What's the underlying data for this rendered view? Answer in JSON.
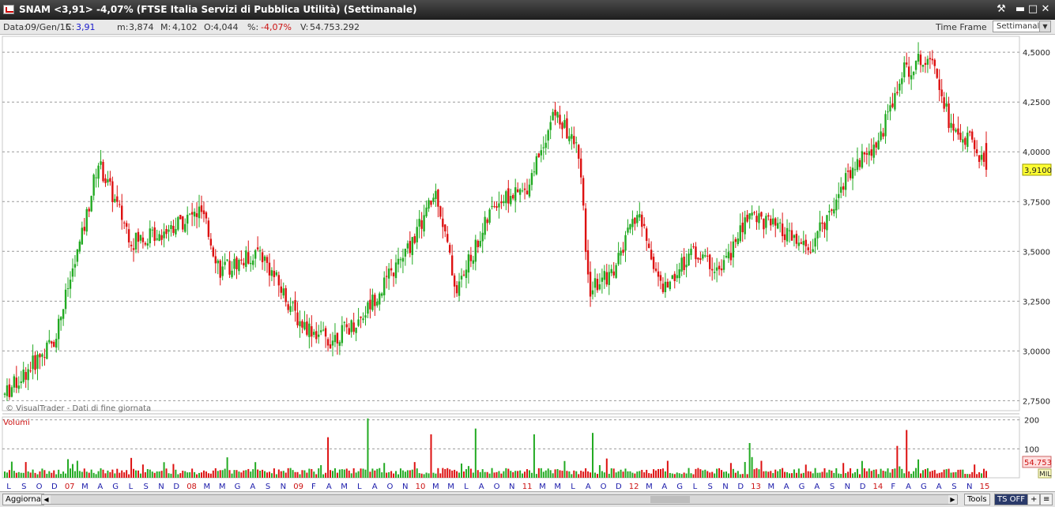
{
  "window": {
    "title": "SNAM <3,91> -4,07%  (FTSE Italia Servizi di Pubblica Utilità)  (Settimanale)",
    "buttons": {
      "tools": "⚒",
      "minimize": "▬",
      "maximize": "□",
      "close": "✕"
    }
  },
  "infobar": {
    "data_label": "Data:",
    "data_value": "09/Gen/15",
    "c_label": "C:",
    "c_value": "3,91",
    "m_label": "m:",
    "m_value": "3,874",
    "M_label": "M:",
    "M_value": "4,102",
    "o_label": "O:",
    "o_value": "4,044",
    "pct_label": "%:",
    "pct_value": "-4,07%",
    "v_label": "V:",
    "v_value": "54.753.292",
    "timeframe_label": "Time Frame",
    "timeframe_value": "Settimanale"
  },
  "chart_data": [
    {
      "type": "candlestick",
      "title": "SNAM <3,91> -4,07%  (FTSE Italia Servizi di Pubblica Utilità)  (Settimanale)",
      "watermark": "© VisualTrader - Dati di fine giornata",
      "y_ticks": [
        "4,5000",
        "4,2500",
        "4,0000",
        "3,7500",
        "3,5000",
        "3,2500",
        "3,0000",
        "2,7500"
      ],
      "ylim": [
        2.7,
        4.58
      ],
      "last_price_label": "3,9100",
      "last_price": 3.91,
      "up_color": "#22aa22",
      "down_color": "#dd1111",
      "grid": true,
      "trend_anchors": [
        {
          "t": 0,
          "p": 2.78
        },
        {
          "t": 0.05,
          "p": 3.05
        },
        {
          "t": 0.08,
          "p": 3.6
        },
        {
          "t": 0.095,
          "p": 3.95
        },
        {
          "t": 0.13,
          "p": 3.55
        },
        {
          "t": 0.16,
          "p": 3.6
        },
        {
          "t": 0.2,
          "p": 3.7
        },
        {
          "t": 0.22,
          "p": 3.4
        },
        {
          "t": 0.26,
          "p": 3.5
        },
        {
          "t": 0.3,
          "p": 3.15
        },
        {
          "t": 0.33,
          "p": 3.05
        },
        {
          "t": 0.36,
          "p": 3.15
        },
        {
          "t": 0.41,
          "p": 3.5
        },
        {
          "t": 0.44,
          "p": 3.8
        },
        {
          "t": 0.46,
          "p": 3.3
        },
        {
          "t": 0.5,
          "p": 3.75
        },
        {
          "t": 0.53,
          "p": 3.8
        },
        {
          "t": 0.56,
          "p": 4.2
        },
        {
          "t": 0.585,
          "p": 4.0
        },
        {
          "t": 0.595,
          "p": 3.3
        },
        {
          "t": 0.62,
          "p": 3.4
        },
        {
          "t": 0.645,
          "p": 3.7
        },
        {
          "t": 0.67,
          "p": 3.3
        },
        {
          "t": 0.7,
          "p": 3.5
        },
        {
          "t": 0.73,
          "p": 3.4
        },
        {
          "t": 0.76,
          "p": 3.7
        },
        {
          "t": 0.79,
          "p": 3.6
        },
        {
          "t": 0.82,
          "p": 3.5
        },
        {
          "t": 0.86,
          "p": 3.9
        },
        {
          "t": 0.89,
          "p": 4.05
        },
        {
          "t": 0.915,
          "p": 4.4
        },
        {
          "t": 0.945,
          "p": 4.5
        },
        {
          "t": 0.965,
          "p": 4.1
        },
        {
          "t": 0.985,
          "p": 4.05
        },
        {
          "t": 1.0,
          "p": 3.91
        }
      ]
    },
    {
      "type": "bar",
      "title": "Volumi",
      "y_ticks": [
        "200",
        "100"
      ],
      "ylim": [
        0,
        210
      ],
      "last_value_label": "54.753",
      "unit_label": "MIL",
      "spikes": [
        {
          "t": 0.37,
          "v": 205
        },
        {
          "t": 0.33,
          "v": 140
        },
        {
          "t": 0.435,
          "v": 150
        },
        {
          "t": 0.48,
          "v": 170
        },
        {
          "t": 0.6,
          "v": 155
        },
        {
          "t": 0.54,
          "v": 150
        },
        {
          "t": 0.76,
          "v": 120
        },
        {
          "t": 0.92,
          "v": 165
        },
        {
          "t": 0.91,
          "v": 110
        }
      ]
    }
  ],
  "x_axis_labels": [
    {
      "text": "L",
      "year": false
    },
    {
      "text": "S",
      "year": false
    },
    {
      "text": "O",
      "year": false
    },
    {
      "text": "D",
      "year": false
    },
    {
      "text": "07",
      "year": true
    },
    {
      "text": "M",
      "year": false
    },
    {
      "text": "A",
      "year": false
    },
    {
      "text": "G",
      "year": false
    },
    {
      "text": "L",
      "year": false
    },
    {
      "text": "S",
      "year": false
    },
    {
      "text": "N",
      "year": false
    },
    {
      "text": "D",
      "year": false
    },
    {
      "text": "08",
      "year": true
    },
    {
      "text": "M",
      "year": false
    },
    {
      "text": "M",
      "year": false
    },
    {
      "text": "G",
      "year": false
    },
    {
      "text": "A",
      "year": false
    },
    {
      "text": "S",
      "year": false
    },
    {
      "text": "N",
      "year": false
    },
    {
      "text": "09",
      "year": true
    },
    {
      "text": "F",
      "year": false
    },
    {
      "text": "A",
      "year": false
    },
    {
      "text": "M",
      "year": false
    },
    {
      "text": "L",
      "year": false
    },
    {
      "text": "A",
      "year": false
    },
    {
      "text": "O",
      "year": false
    },
    {
      "text": "N",
      "year": false
    },
    {
      "text": "10",
      "year": true
    },
    {
      "text": "M",
      "year": false
    },
    {
      "text": "M",
      "year": false
    },
    {
      "text": "L",
      "year": false
    },
    {
      "text": "A",
      "year": false
    },
    {
      "text": "O",
      "year": false
    },
    {
      "text": "N",
      "year": false
    },
    {
      "text": "11",
      "year": true
    },
    {
      "text": "M",
      "year": false
    },
    {
      "text": "M",
      "year": false
    },
    {
      "text": "L",
      "year": false
    },
    {
      "text": "A",
      "year": false
    },
    {
      "text": "O",
      "year": false
    },
    {
      "text": "D",
      "year": false
    },
    {
      "text": "12",
      "year": true
    },
    {
      "text": "M",
      "year": false
    },
    {
      "text": "A",
      "year": false
    },
    {
      "text": "G",
      "year": false
    },
    {
      "text": "L",
      "year": false
    },
    {
      "text": "S",
      "year": false
    },
    {
      "text": "N",
      "year": false
    },
    {
      "text": "D",
      "year": false
    },
    {
      "text": "13",
      "year": true
    },
    {
      "text": "M",
      "year": false
    },
    {
      "text": "A",
      "year": false
    },
    {
      "text": "G",
      "year": false
    },
    {
      "text": "A",
      "year": false
    },
    {
      "text": "S",
      "year": false
    },
    {
      "text": "N",
      "year": false
    },
    {
      "text": "D",
      "year": false
    },
    {
      "text": "14",
      "year": true
    },
    {
      "text": "F",
      "year": false
    },
    {
      "text": "A",
      "year": false
    },
    {
      "text": "G",
      "year": false
    },
    {
      "text": "A",
      "year": false
    },
    {
      "text": "S",
      "year": false
    },
    {
      "text": "N",
      "year": false
    },
    {
      "text": "15",
      "year": true
    }
  ],
  "bottom": {
    "refresh_label": "Aggiorna",
    "tools_label": "Tools",
    "ts_label": "TS OFF",
    "plus_label": "+",
    "menu_label": "≡",
    "left_arrow": "◀",
    "right_arrow": "▶"
  },
  "colors": {
    "up": "#22aa22",
    "down": "#dd1111",
    "grid": "#9a9a9a",
    "year_label": "#cc1111",
    "month_label": "#1a1aaa"
  }
}
